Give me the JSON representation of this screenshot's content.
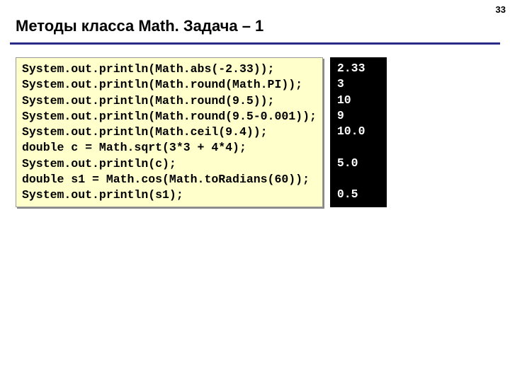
{
  "page_number": "33",
  "title": "Методы класса Math. Задача – 1",
  "code": {
    "lines": [
      "System.out.println(Math.abs(-2.33));",
      "System.out.println(Math.round(Math.PI));",
      "System.out.println(Math.round(9.5));",
      "System.out.println(Math.round(9.5-0.001));",
      "System.out.println(Math.ceil(9.4));",
      "double c = Math.sqrt(3*3 + 4*4);",
      "System.out.println(c);",
      "double s1 = Math.cos(Math.toRadians(60));",
      "System.out.println(s1);"
    ]
  },
  "output": {
    "lines": [
      "2.33",
      "3",
      "10",
      "9",
      "10.0",
      "",
      "5.0",
      "",
      "0.5"
    ]
  }
}
